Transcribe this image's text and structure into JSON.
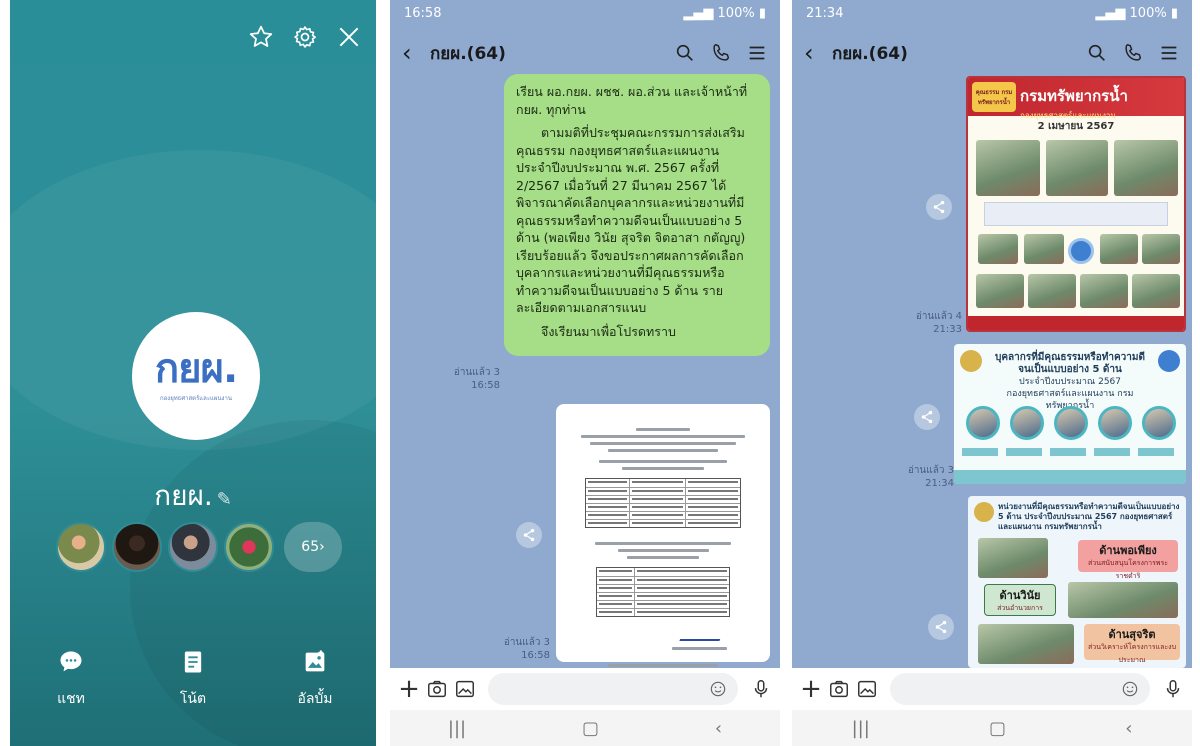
{
  "colors": {
    "profile_bg": "#2f8c95",
    "chat_bg": "#8fa9cf",
    "my_bubble": "#a5de86",
    "poster_red": "#c0262e"
  },
  "profile": {
    "logo_text": "กยผ.",
    "logo_sub": "กองยุทธศาสตร์และแผนงาน",
    "group_name": "กยผ.",
    "member_count": "65",
    "actions": [
      {
        "label": "แชท",
        "icon": "chat-icon"
      },
      {
        "label": "โน้ต",
        "icon": "note-icon"
      },
      {
        "label": "อัลบั้ม",
        "icon": "album-icon"
      }
    ]
  },
  "chat1": {
    "time": "16:58",
    "battery": "100%",
    "title": "กยผ.(64)",
    "message": {
      "p1": "เรียน ผอ.กยผ. ผชช. ผอ.ส่วน และเจ้าหน้าที่ กยผ. ทุกท่าน",
      "p2": "ตามมติที่ประชุมคณะกรรมการส่งเสริมคุณธรรม กองยุทธศาสตร์และแผนงาน ประจำปีงบประมาณ พ.ศ. 2567 ครั้งที่ 2/2567 เมื่อวันที่ 27 มีนาคม 2567 ได้พิจารณาคัดเลือกบุคลากรและหน่วยงานที่มีคุณธรรมหรือทำความดีจนเป็นแบบอย่าง 5 ด้าน (พอเพียง วินัย สุจริต จิตอาสา กตัญญู) เรียบร้อยแล้ว จึงขอประกาศผลการคัดเลือกบุคลากรและหน่วยงานที่มีคุณธรรมหรือทำความดีจนเป็นแบบอย่าง 5 ด้าน รายละเอียดตามเอกสารแนบ",
      "p3": "จึงเรียนมาเพื่อโปรดทราบ",
      "read": "อ่านแล้ว 3",
      "time": "16:58"
    },
    "doc": {
      "read": "อ่านแล้ว 3",
      "time": "16:58"
    }
  },
  "chat2": {
    "time": "21:34",
    "battery": "100%",
    "title": "กยผ.(64)",
    "poster1": {
      "brand": "คุณธรรม กรมทรัพยากรน้ำ",
      "title": "กรมทรัพยากรน้ำ",
      "subtitle": "กองยุทธศาสตร์และแผนงาน",
      "date": "2 เมษายน 2567",
      "read": "อ่านแล้ว 4",
      "time": "21:33"
    },
    "poster2": {
      "line1": "บุคลากรที่มีคุณธรรมหรือทำความดีจนเป็นแบบอย่าง 5 ด้าน",
      "line2": "ประจำปีงบประมาณ 2567",
      "line3": "กองยุทธศาสตร์และแผนงาน กรมทรัพยากรน้ำ",
      "read": "อ่านแล้ว 3",
      "time": "21:34"
    },
    "poster3": {
      "title": "หน่วยงานที่มีคุณธรรมหรือทำความดีจนเป็นแบบอย่าง 5 ด้าน ประจำปีงบประมาณ 2567 กองยุทธศาสตร์และแผนงาน กรมทรัพยากรน้ำ",
      "tag1": "ด้านพอเพียง",
      "tag1_sub": "ส่วนสนับสนุนโครงการพระราชดำริ",
      "tag2": "ด้านวินัย",
      "tag2_sub": "ส่วนอำนวยการ",
      "tag3": "ด้านสุจริต",
      "tag3_sub": "ส่วนวิเคราะห์โครงการและงบประมาณ"
    }
  }
}
